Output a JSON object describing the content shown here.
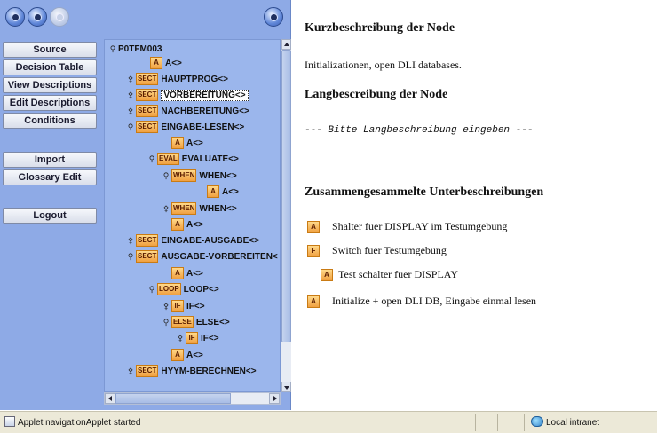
{
  "toolbar": {
    "back_icon": "back-arrow-icon",
    "forward_icon": "forward-arrow-icon",
    "home_icon": "home-icon",
    "refresh_icon": "refresh-icon"
  },
  "sidebar": {
    "source": "Source",
    "decision_table": "Decision Table",
    "view_descriptions": "View Descriptions",
    "edit_descriptions": "Edit Descriptions",
    "conditions": "Conditions",
    "import": "Import",
    "glossary_edit": "Glossary Edit",
    "logout": "Logout"
  },
  "tree": {
    "nodes": [
      {
        "badge": "",
        "label": "P0TFM003"
      },
      {
        "badge": "A",
        "label": "A<>"
      },
      {
        "badge": "SECT",
        "label": "HAUPTPROG<>"
      },
      {
        "badge": "SECT",
        "label": "VORBEREITUNG<>"
      },
      {
        "badge": "SECT",
        "label": "NACHBEREITUNG<>"
      },
      {
        "badge": "SECT",
        "label": "EINGABE-LESEN<>"
      },
      {
        "badge": "A",
        "label": "A<>"
      },
      {
        "badge": "EVAL",
        "label": "EVALUATE<>"
      },
      {
        "badge": "WHEN",
        "label": "WHEN<>"
      },
      {
        "badge": "A",
        "label": "A<>"
      },
      {
        "badge": "WHEN",
        "label": "WHEN<>"
      },
      {
        "badge": "A",
        "label": "A<>"
      },
      {
        "badge": "SECT",
        "label": "EINGABE-AUSGABE<>"
      },
      {
        "badge": "SECT",
        "label": "AUSGABE-VORBEREITEN<"
      },
      {
        "badge": "A",
        "label": "A<>"
      },
      {
        "badge": "LOOP",
        "label": "LOOP<>"
      },
      {
        "badge": "IF",
        "label": "IF<>"
      },
      {
        "badge": "ELSE",
        "label": "ELSE<>"
      },
      {
        "badge": "IF",
        "label": "IF<>"
      },
      {
        "badge": "A",
        "label": "A<>"
      },
      {
        "badge": "SECT",
        "label": "HYYM-BERECHNEN<>"
      }
    ]
  },
  "content": {
    "kurz_title": "Kurzbeschreibung der Node",
    "kurz_text": "Initializationen, open DLI databases.",
    "lang_title": "Langbescreibung der Node",
    "lang_text": "--- Bitte Langbeschreibung eingeben ---",
    "summary_title": "Zusammengesammelte Unterbeschreibungen",
    "summary": [
      {
        "badge": "A",
        "text": "Shalter fuer DISPLAY im Testumgebung"
      },
      {
        "badge": "F",
        "text": "Switch fuer Testumgebung"
      },
      {
        "badge": "A",
        "text": "Test schalter fuer DISPLAY"
      },
      {
        "badge": "A",
        "text": "Initialize + open DLI DB, Eingabe einmal lesen"
      }
    ]
  },
  "status": {
    "message": "Applet navigationApplet started",
    "zone": "Local intranet"
  }
}
